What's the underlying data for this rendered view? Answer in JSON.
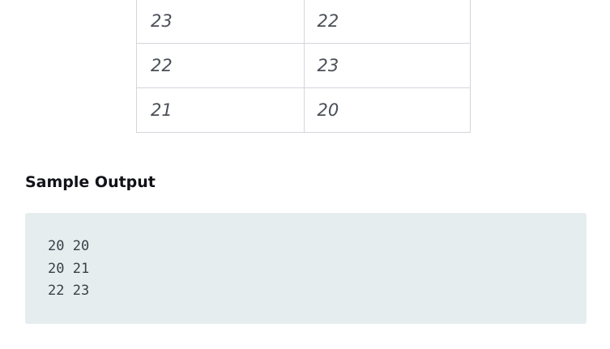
{
  "table": {
    "rows": [
      [
        "23",
        "22"
      ],
      [
        "22",
        "23"
      ],
      [
        "21",
        "20"
      ]
    ]
  },
  "sample_output": {
    "heading": "Sample Output",
    "lines": [
      "20 20",
      "20 21",
      "22 23"
    ]
  }
}
